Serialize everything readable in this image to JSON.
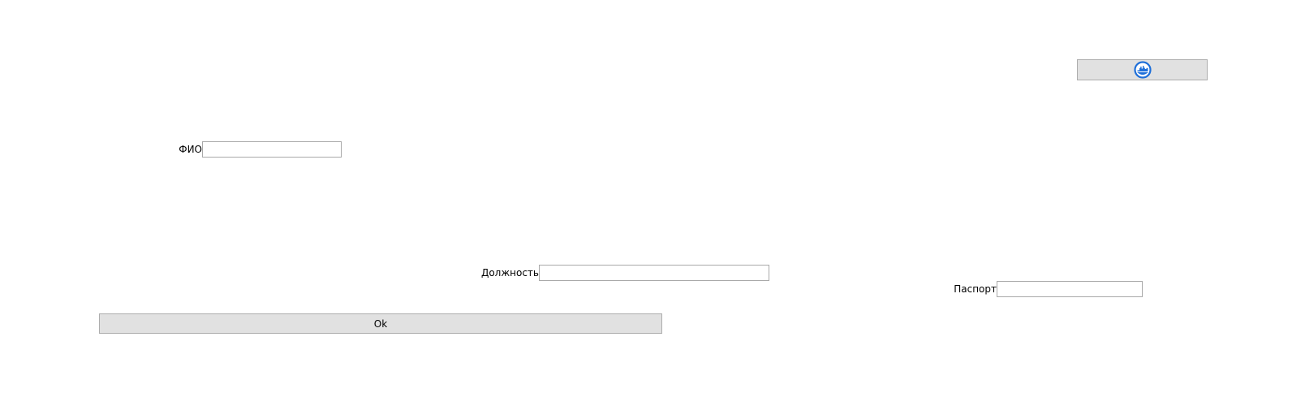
{
  "toolbar": {
    "refresh_icon": "refresh-icon",
    "icon_color": "#1e6fd9"
  },
  "form": {
    "fio": {
      "label": "ФИО",
      "value": ""
    },
    "position": {
      "label": "Должность",
      "value": ""
    },
    "passport": {
      "label": "Паспорт",
      "value": ""
    },
    "ok_label": "Ok"
  }
}
